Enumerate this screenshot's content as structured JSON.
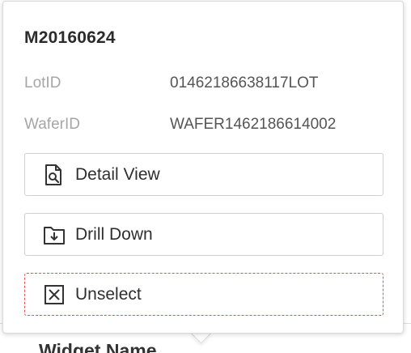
{
  "background": {
    "heading": "Widget Name"
  },
  "popover": {
    "title": "M20160624",
    "fields": [
      {
        "label": "LotID",
        "value": "01462186638117LOT"
      },
      {
        "label": "WaferID",
        "value": "WAFER1462186614002"
      }
    ],
    "actions": {
      "detail_view": {
        "label": "Detail View",
        "icon": "document-search-icon"
      },
      "drill_down": {
        "label": "Drill Down",
        "icon": "folder-download-icon"
      },
      "unselect": {
        "label": "Unselect",
        "icon": "close-box-icon",
        "border_color": "#e6505a"
      }
    }
  }
}
